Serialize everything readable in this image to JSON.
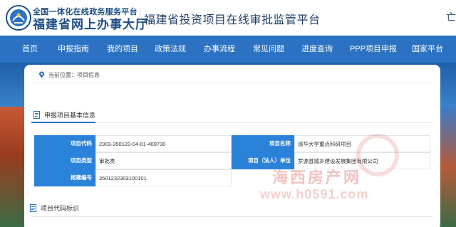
{
  "header": {
    "logo_line1": "全国一体化在线政务服务平台",
    "logo_line2": "福建省网上办事大厅",
    "site_title": "福建省投资项目在线审批监管平台",
    "tail_glyph": "亡"
  },
  "nav": {
    "items": [
      "首页",
      "申报指南",
      "我的项目",
      "政策法规",
      "办事流程",
      "常见问题",
      "进度查询",
      "PPP项目申报",
      "国家平台"
    ]
  },
  "breadcrumb": {
    "prefix": "当前位置：",
    "current": "项目信息"
  },
  "section_basic": {
    "title": "申报项目基本信息"
  },
  "table": {
    "rows": [
      {
        "label1": "项目代码",
        "value1": "2303-350123-04-01-409730",
        "label2": "项目名称",
        "value2": "清华大学重点科研项目"
      },
      {
        "label1": "项目类型",
        "value1": "审批类",
        "label2": "项目（法人）单位",
        "value2": "罗源县城乡建设发展集团有限公司"
      },
      {
        "label1": "报建编号",
        "value1": "3501232303100101"
      }
    ]
  },
  "section_code": {
    "title": "项目代码标识"
  },
  "watermark": {
    "line1": "海西房产网",
    "line2": "www.h0591.com"
  },
  "colors": {
    "nav_bg": "#2b72c2",
    "label_bg": "#2b82d9",
    "title_color": "#1d4e86",
    "watermark": "#d84242"
  }
}
